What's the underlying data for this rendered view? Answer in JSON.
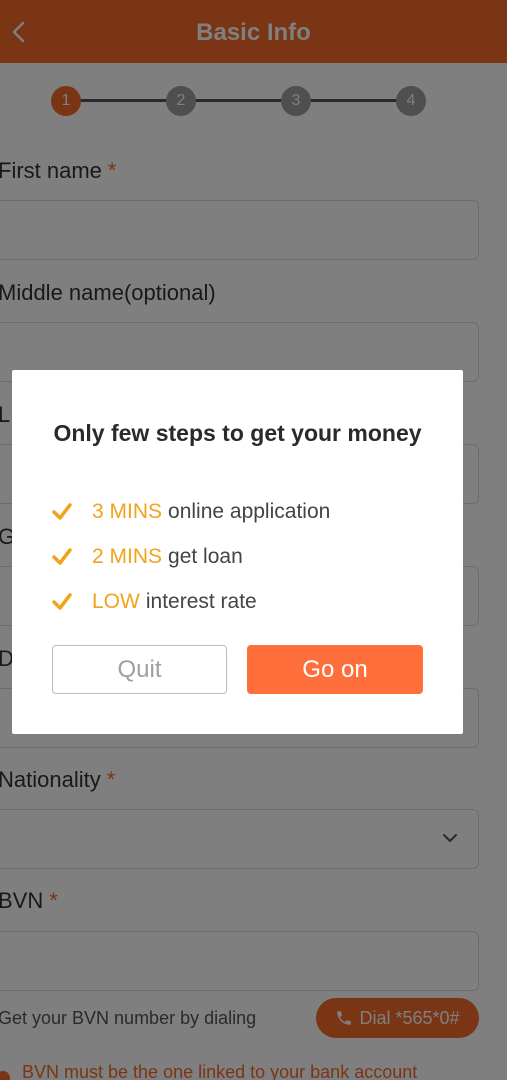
{
  "header": {
    "title": "Basic Info"
  },
  "stepper": {
    "steps": [
      "1",
      "2",
      "3",
      "4"
    ],
    "active": 1
  },
  "form": {
    "required_mark": "*",
    "first_name_label": "First name",
    "middle_name_label": "Middle name(optional)",
    "last_name_label_visible": "L",
    "gender_label_visible": "G",
    "dob_label_visible": "D",
    "nationality_label": "Nationality",
    "bvn_label": "BVN",
    "bvn_helper": "Get your BVN number by dialing",
    "dial_button": "Dial *565*0#",
    "bvn_notice": "BVN must be the one linked to your bank account"
  },
  "modal": {
    "title": "Only few steps to get your money",
    "bullets": [
      {
        "highlight": "3 MINS",
        "text": "online application"
      },
      {
        "highlight": "2 MINS",
        "text": "get loan"
      },
      {
        "highlight": "LOW",
        "text": "interest rate"
      }
    ],
    "quit_button": "Quit",
    "go_button": "Go on"
  },
  "colors": {
    "brand": "#f26a28",
    "highlight": "#f2a31c",
    "go_button": "#ff6f3c"
  },
  "icons": {
    "back": "chevron-left-icon",
    "check": "check-icon",
    "dropdown": "chevron-down-icon",
    "phone": "phone-icon"
  }
}
